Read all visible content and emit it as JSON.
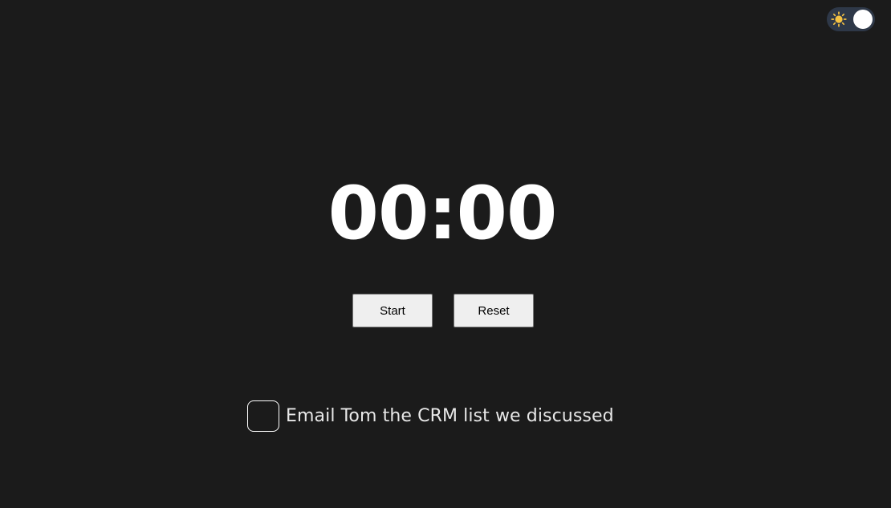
{
  "theme_toggle": {
    "icon": "sun-icon",
    "state": "light-knob-right"
  },
  "timer": {
    "display": "00:00"
  },
  "controls": {
    "start_label": "Start",
    "reset_label": "Reset"
  },
  "task": {
    "checked": false,
    "text": "Email Tom the CRM list we discussed"
  },
  "colors": {
    "background": "#1b1b1b",
    "toggle_track": "#2e3848",
    "sun": "#f6c343",
    "button_bg": "#efefef"
  }
}
